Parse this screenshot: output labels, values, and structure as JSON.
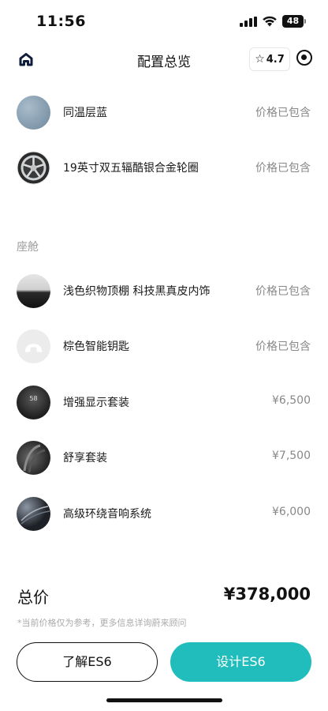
{
  "status_bar": {
    "time": "11:56",
    "battery": "48"
  },
  "nav": {
    "title": "配置总览",
    "rating": "4.7",
    "rating_icon": "star-outline-icon",
    "home_icon": "home-icon",
    "target_icon": "target-icon"
  },
  "exterior_items": [
    {
      "label": "同温层蓝",
      "price": "价格已包含",
      "thumb": "blue-paint-swatch"
    },
    {
      "label": "19英寸双五辐酷银合金轮圈",
      "price": "价格已包含",
      "thumb": "alloy-wheel"
    }
  ],
  "cabin": {
    "title": "座舱",
    "items": [
      {
        "label": "浅色织物顶棚 科技黑真皮内饰",
        "price": "价格已包含",
        "thumb": "headliner-interior"
      },
      {
        "label": "棕色智能钥匙",
        "price": "价格已包含",
        "thumb": "smart-key"
      },
      {
        "label": "增强显示套装",
        "price": "¥6,500",
        "thumb": "display-package",
        "thumb_text": "58"
      },
      {
        "label": "舒享套装",
        "price": "¥7,500",
        "thumb": "comfort-seat"
      },
      {
        "label": "高级环绕音响系统",
        "price": "¥6,000",
        "thumb": "audio-system"
      }
    ]
  },
  "total": {
    "label": "总价",
    "value": "¥378,000",
    "note": "*当前价格仅为参考，更多信息详询蔚来顾问"
  },
  "buttons": {
    "learn": "了解ES6",
    "design": "设计ES6"
  },
  "colors": {
    "accent": "#21bdbd",
    "text": "#111111",
    "muted": "#888888"
  }
}
